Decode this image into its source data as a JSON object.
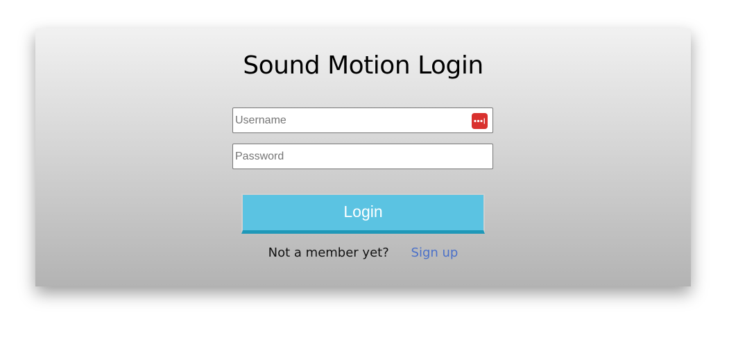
{
  "login": {
    "title": "Sound Motion Login",
    "username_placeholder": "Username",
    "password_placeholder": "Password",
    "password_manager_icon": "password-manager-icon",
    "submit_label": "Login",
    "signup_prompt": "Not a member yet?",
    "signup_link": "Sign up"
  },
  "colors": {
    "button_fill": "#5bc3e2",
    "button_bottom_border": "#1f98b8",
    "link": "#4a70c9",
    "password_manager_badge": "#d9312e"
  }
}
